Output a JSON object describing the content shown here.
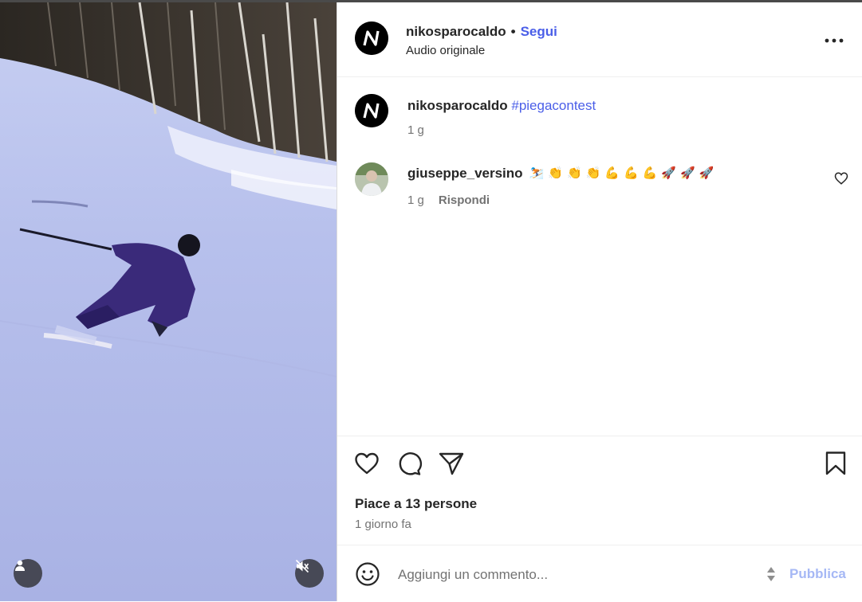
{
  "post": {
    "username": "nikosparocaldo",
    "follow_label": "Segui",
    "separator": "•",
    "audio_label": "Audio originale",
    "more_icon": "more-horizontal-icon"
  },
  "caption": {
    "username": "nikosparocaldo",
    "hashtag": "#piegacontest",
    "time": "1 g"
  },
  "comments": [
    {
      "username": "giuseppe_versino",
      "emojis": [
        "⛷️",
        "👏",
        "👏",
        "👏",
        "💪",
        "💪",
        "💪",
        "🚀",
        "🚀",
        "🚀"
      ],
      "time": "1 g",
      "reply_label": "Rispondi"
    }
  ],
  "engagement": {
    "likes_text": "Piace a 13 persone",
    "date_text": "1 giorno fa"
  },
  "composer": {
    "placeholder": "Aggiungi un commento...",
    "publish_label": "Pubblica"
  },
  "media": {
    "tag_icon": "user-tag-icon",
    "mute_icon": "speaker-muted-icon"
  },
  "colors": {
    "link": "#4a5ee8",
    "publish_disabled": "#a6b8f5",
    "secondary_text": "#737373",
    "snow": "#b6bfea"
  }
}
